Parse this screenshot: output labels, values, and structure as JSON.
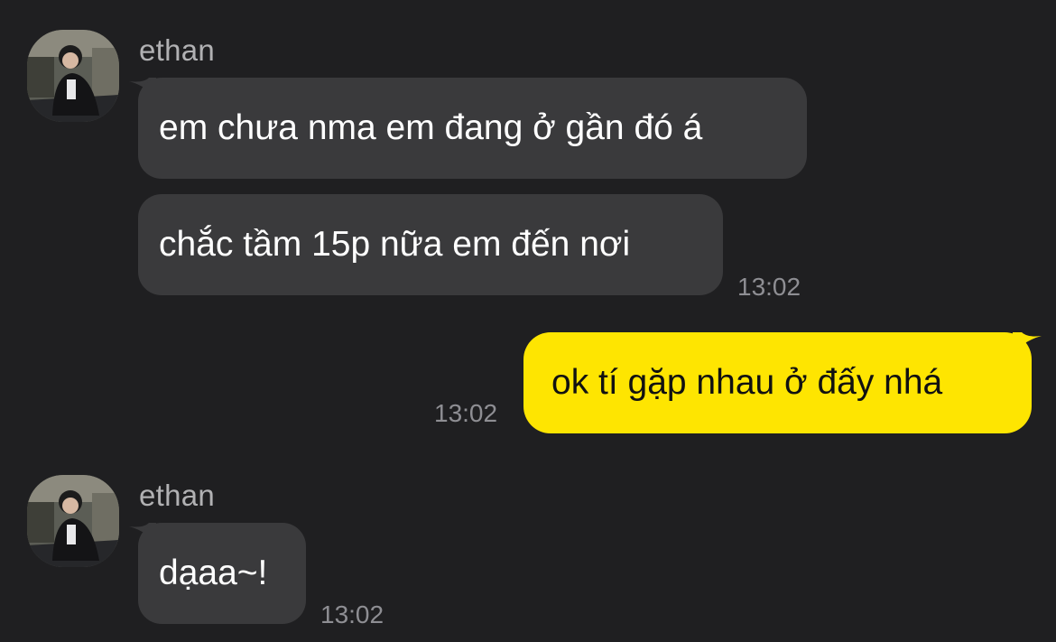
{
  "messages": [
    {
      "sender": "ethan",
      "bubbles": [
        "em chưa nma em đang ở gần đó á",
        "chắc tầm 15p nữa em đến nơi"
      ],
      "time": "13:02"
    },
    {
      "sender": "me",
      "bubbles": [
        "ok tí gặp nhau ở đấy nhá"
      ],
      "time": "13:02"
    },
    {
      "sender": "ethan",
      "bubbles": [
        "dạaa~!"
      ],
      "time": "13:02"
    }
  ],
  "colors": {
    "background": "#1f1f21",
    "incoming_bubble": "#3a3a3c",
    "outgoing_bubble": "#fee501",
    "timestamp": "#8e8e93"
  }
}
